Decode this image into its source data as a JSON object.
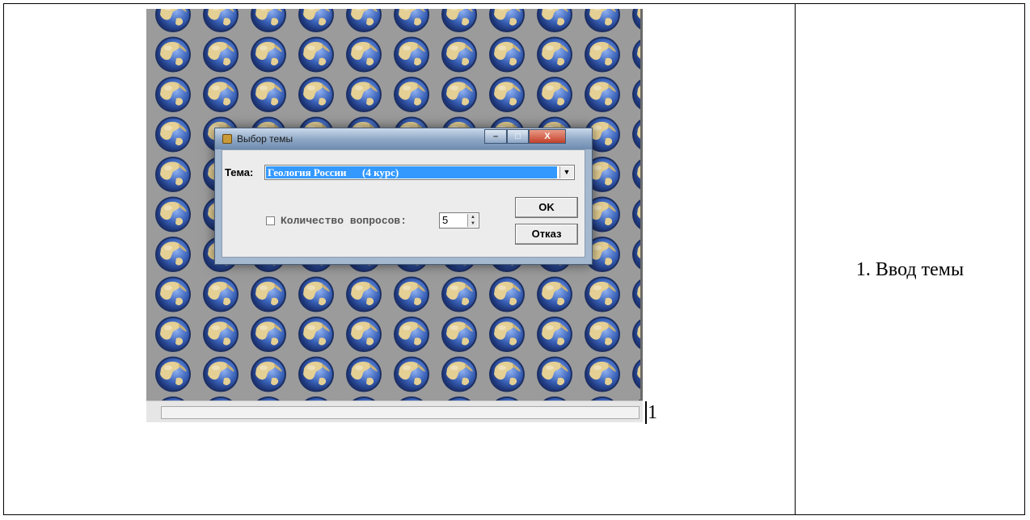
{
  "dialog": {
    "title": "Выбор темы",
    "theme_label": "Тема:",
    "theme_value": "Геология России      (4 курс)",
    "count_label": "Количество вопросов:",
    "count_checked": false,
    "count_value": "5",
    "ok_label": "OK",
    "cancel_label": "Отказ",
    "min_glyph": "–",
    "max_glyph": "□",
    "close_glyph": "X"
  },
  "figure": {
    "number": "1",
    "caption": "1. Ввод темы"
  },
  "background": {
    "tile_icon": "globe-icon",
    "colors": {
      "backdrop": "#9b9b9b",
      "ocean": "#2a4ea0",
      "land": "#e2cc90"
    }
  },
  "icons": {
    "dropdown": "chevron-down-icon",
    "spinner": "spinner-arrows-icon",
    "window": "app-icon"
  }
}
